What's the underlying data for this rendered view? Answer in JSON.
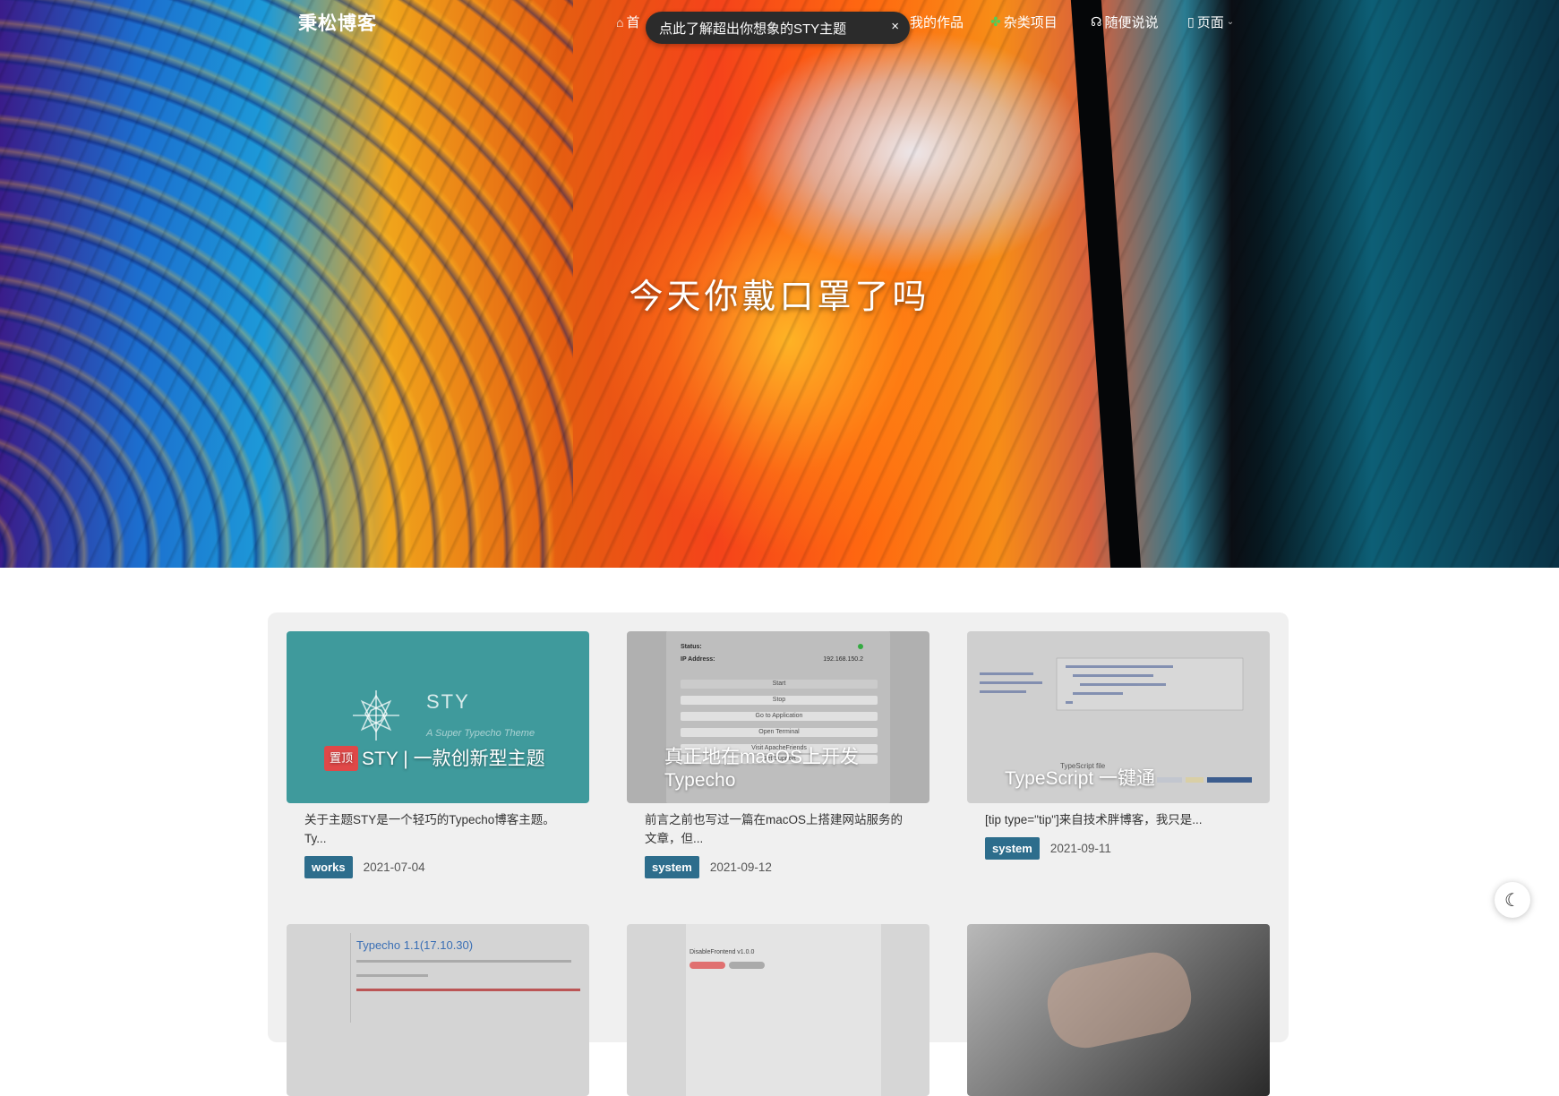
{
  "nav": {
    "brand": "秉松博客",
    "items": [
      {
        "label": "首",
        "icon": "home-icon"
      },
      {
        "label": "我的作品",
        "icon": ""
      },
      {
        "label": "杂类项目",
        "icon": "puzzle-icon"
      },
      {
        "label": "随便说说",
        "icon": "headphones-icon"
      },
      {
        "label": "页面",
        "icon": "page-icon"
      }
    ]
  },
  "toast": {
    "text": "点此了解超出你想象的STY主题",
    "close": "×"
  },
  "hero": {
    "title": "今天你戴口罩了吗"
  },
  "posts": [
    {
      "pin_label": "置顶",
      "title": "STY | 一款创新型主题",
      "excerpt": "关于主题STY是一个轻巧的Typecho博客主题。Ty...",
      "tag": "works",
      "date": "2021-07-04",
      "thumb_brand": "STY",
      "thumb_sub": "A Super Typecho Theme",
      "thumb_color": "#3f9a9c"
    },
    {
      "title": "真正地在macOS上开发Typecho",
      "excerpt": "前言之前也写过一篇在macOS上搭建网站服务的文章，但...",
      "tag": "system",
      "date": "2021-09-12",
      "thumb_lines": {
        "status_label": "Status:",
        "ip_label": "IP Address:",
        "ip_value": "192.168.150.2",
        "buttons": [
          "Start",
          "Stop",
          "Go to Application",
          "Open Terminal",
          "Visit ApacheFriends",
          "Get Support"
        ]
      }
    },
    {
      "title": "TypeScript 一键通",
      "excerpt": "[tip type=\"tip\"]来自技术胖博客，我只是...",
      "tag": "system",
      "date": "2021-09-11",
      "thumb_caption": "TypeScript file"
    },
    {
      "thumb_heading": "Typecho 1.1(17.10.30)"
    },
    {
      "thumb_heading": "DisableFrontend v1.0.0"
    },
    {
      "thumb_heading": ""
    }
  ],
  "dark_mode_icon": "moon-icon"
}
